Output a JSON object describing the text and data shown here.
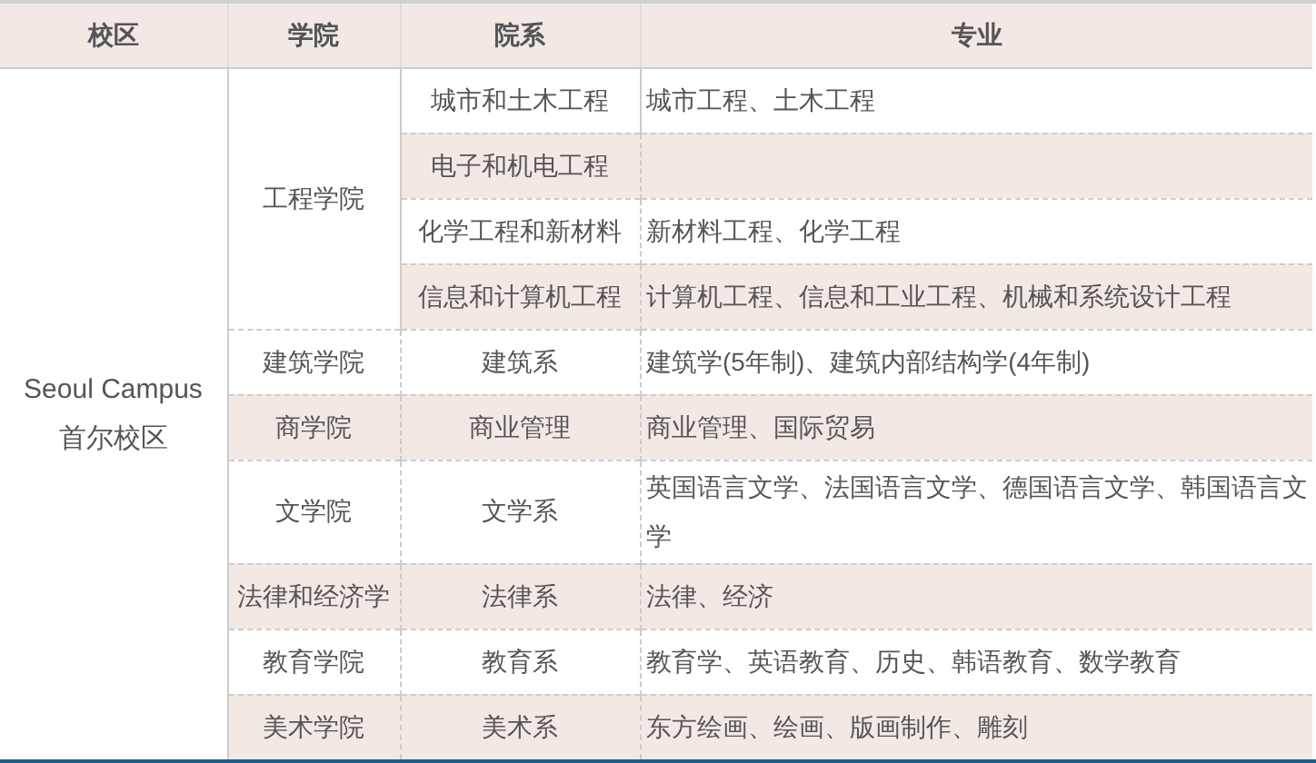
{
  "columns": [
    "校区",
    "学院",
    "院系",
    "专业"
  ],
  "campus": {
    "lines": [
      "Seoul Campus",
      "首尔校区"
    ]
  },
  "colleges": [
    {
      "name": "工程学院",
      "departments": [
        {
          "name": "城市和土木工程",
          "majors": "城市工程、土木工程"
        },
        {
          "name": "电子和机电工程"
        },
        {
          "name": "化学工程和新材料",
          "majors": "新材料工程、化学工程"
        },
        {
          "name": "信息和计算机工程",
          "majors": "计算机工程、信息和工业工程、机械和系统设计工程"
        }
      ]
    },
    {
      "name": "建筑学院",
      "departments": [
        {
          "name": "建筑系",
          "majors": "建筑学(5年制)、建筑内部结构学(4年制)"
        }
      ]
    },
    {
      "name": "商学院",
      "departments": [
        {
          "name": "商业管理",
          "majors": "商业管理、国际贸易"
        }
      ]
    },
    {
      "name": "文学院",
      "departments": [
        {
          "name": "文学系",
          "majors": "英国语言文学、法国语言文学、德国语言文学、韩国语言文学"
        }
      ]
    },
    {
      "name": "法律和经济学",
      "departments": [
        {
          "name": "法律系",
          "majors": "法律、经济"
        }
      ]
    },
    {
      "name": "教育学院",
      "departments": [
        {
          "name": "教育系",
          "majors": "教育学、英语教育、历史、韩语教育、数学教育"
        }
      ]
    },
    {
      "name": "美术学院",
      "departments": [
        {
          "name": "美术系",
          "majors": "东方绘画、绘画、版画制作、雕刻"
        }
      ]
    }
  ]
}
